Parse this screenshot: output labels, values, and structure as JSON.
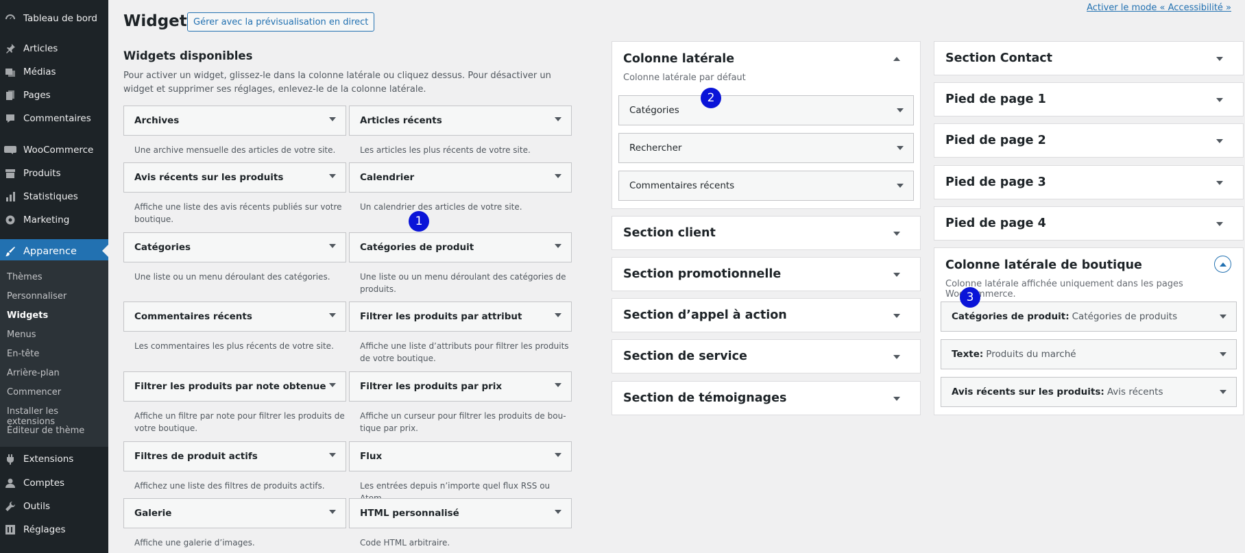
{
  "sidebar": {
    "items": [
      {
        "label": "Tableau de bord",
        "icon": "dashboard-icon"
      },
      {
        "label": "Articles",
        "icon": "pin-icon"
      },
      {
        "label": "Médias",
        "icon": "media-icon"
      },
      {
        "label": "Pages",
        "icon": "pages-icon"
      },
      {
        "label": "Commentaires",
        "icon": "comment-icon"
      },
      {
        "label": "WooCommerce",
        "icon": "woo-icon"
      },
      {
        "label": "Produits",
        "icon": "archive-icon"
      },
      {
        "label": "Statistiques",
        "icon": "chart-icon"
      },
      {
        "label": "Marketing",
        "icon": "megaphone-icon"
      },
      {
        "label": "Apparence",
        "icon": "brush-icon"
      },
      {
        "label": "Extensions",
        "icon": "plugin-icon"
      },
      {
        "label": "Comptes",
        "icon": "user-icon"
      },
      {
        "label": "Outils",
        "icon": "wrench-icon"
      },
      {
        "label": "Réglages",
        "icon": "settings-icon"
      }
    ],
    "submenu": [
      "Thèmes",
      "Personnaliser",
      "Widgets",
      "Menus",
      "En-tête",
      "Arrière-plan",
      "Commencer",
      "Installer les extensions",
      "Éditeur de thème"
    ]
  },
  "header": {
    "title": "Widgets",
    "live_button": "Gérer avec la prévisualisation en direct",
    "a11y_link": "Activer le mode « Accessibilité »"
  },
  "available": {
    "title": "Widgets disponibles",
    "desc": "Pour activer un widget, glissez-le dans la colonne latérale ou cliquez dessus. Pour désactiver un widget et supprimer ses réglages, enlevez-le de la colonne latérale.",
    "widgets": [
      {
        "name": "Archives",
        "desc": "Une archive mensuelle des articles de votre site."
      },
      {
        "name": "Articles récents",
        "desc": "Les articles les plus récents de votre site."
      },
      {
        "name": "Avis récents sur les produits",
        "desc": "Affiche une liste des avis récents publiés sur votre boutique."
      },
      {
        "name": "Calendrier",
        "desc": "Un calendrier des articles de votre site."
      },
      {
        "name": "Catégories",
        "desc": "Une liste ou un menu déroulant des catégories."
      },
      {
        "name": "Catégories de produit",
        "desc": "Une liste ou un menu déroulant des catégories de produits."
      },
      {
        "name": "Commentaires récents",
        "desc": "Les commentaires les plus récents de votre site."
      },
      {
        "name": "Filtrer les produits par attribut",
        "desc": "Affiche une liste d’attributs pour filtrer les produits de votre boutique."
      },
      {
        "name": "Filtrer les produits par note obtenue",
        "desc": "Affiche un filtre par note pour filtrer les produits de votre boutique."
      },
      {
        "name": "Filtrer les produits par prix",
        "desc": "Affiche un curseur pour filtrer les produits de bou­tique par prix."
      },
      {
        "name": "Filtres de produit actifs",
        "desc": "Affichez une liste des filtres de produits actifs."
      },
      {
        "name": "Flux",
        "desc": "Les entrées depuis n’importe quel flux RSS ou Atom."
      },
      {
        "name": "Galerie",
        "desc": "Affiche une galerie d’images."
      },
      {
        "name": "HTML personnalisé",
        "desc": "Code HTML arbitraire."
      }
    ]
  },
  "areas_col1": {
    "main": {
      "title": "Colonne latérale",
      "desc": "Colonne latérale par défaut",
      "widgets": [
        "Catégories",
        "Rechercher",
        "Commentaires récents"
      ]
    },
    "others": [
      "Section client",
      "Section promotionnelle",
      "Section d’appel à action",
      "Section de service",
      "Section de témoignages"
    ]
  },
  "areas_col2": {
    "others": [
      "Section Contact",
      "Pied de page 1",
      "Pied de page 2",
      "Pied de page 3",
      "Pied de page 4"
    ],
    "shop": {
      "title": "Colonne latérale de boutique",
      "desc": "Colonne latérale affichée uniquement dans les pages WooCommerce.",
      "widgets": [
        {
          "type": "Catégories de produit:",
          "title": "Catégories de produits"
        },
        {
          "type": "Texte:",
          "title": "Produits du marché"
        },
        {
          "type": "Avis récents sur les produits:",
          "title": "Avis récents"
        }
      ]
    }
  },
  "markers": [
    "1",
    "2",
    "3"
  ]
}
